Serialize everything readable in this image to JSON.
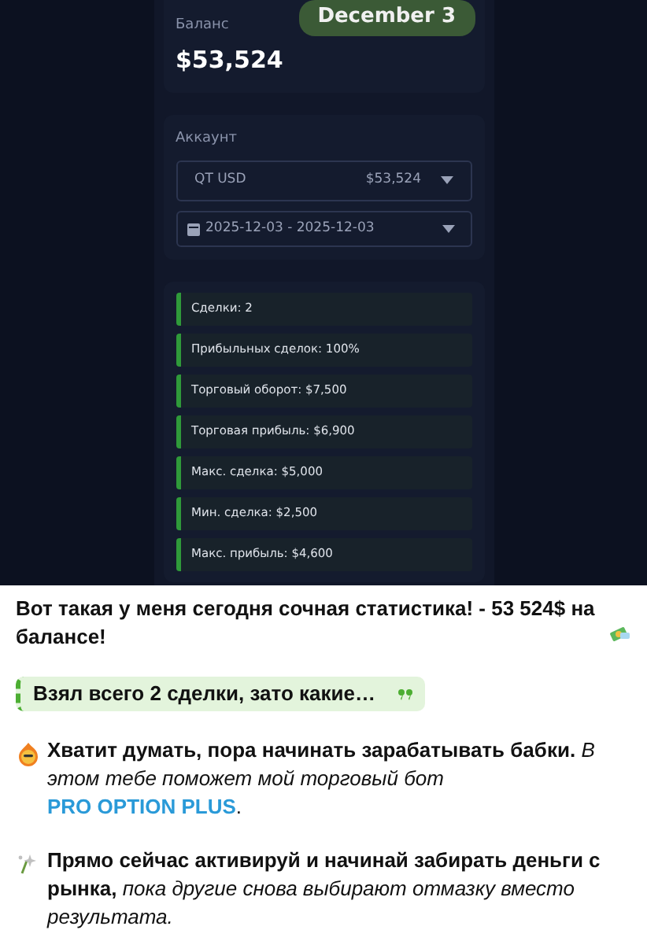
{
  "screenshot": {
    "date_badge": "December 3",
    "balance": {
      "label": "Баланс",
      "value": "$53,524"
    },
    "account": {
      "label": "Аккаунт",
      "select": {
        "name": "QT USD",
        "amount": "$53,524"
      },
      "date_range": "2025-12-03 - 2025-12-03"
    },
    "stats": [
      "Сделки: 2",
      "Прибыльных сделок: 100%",
      "Торговый оборот: $7,500",
      "Торговая прибыль: $6,900",
      "Макс. сделка: $5,000",
      "Мин. сделка: $2,500",
      "Макс. прибыль: $4,600"
    ]
  },
  "post": [
    {
      "kind": "text",
      "text": "**Вот такая у меня сегодня сочная статистика! - 53 524$ на балансе!**"
    },
    {
      "kind": "quote",
      "text": "Взял всего 2 сделки, зато какие…"
    },
    {
      "kind": "text",
      "text": "**Хватит думать, пора начинать зарабатывать бабки.** *В этом тебе поможет мой торговый бот*",
      "link": "PRO OPTION PLUS",
      "after": "."
    },
    {
      "kind": "text",
      "text": "**Прямо сейчас активируй и начинай забирать деньги с рынка,** *пока другие снова выбирают отмазку вместо результата.*"
    }
  ]
}
